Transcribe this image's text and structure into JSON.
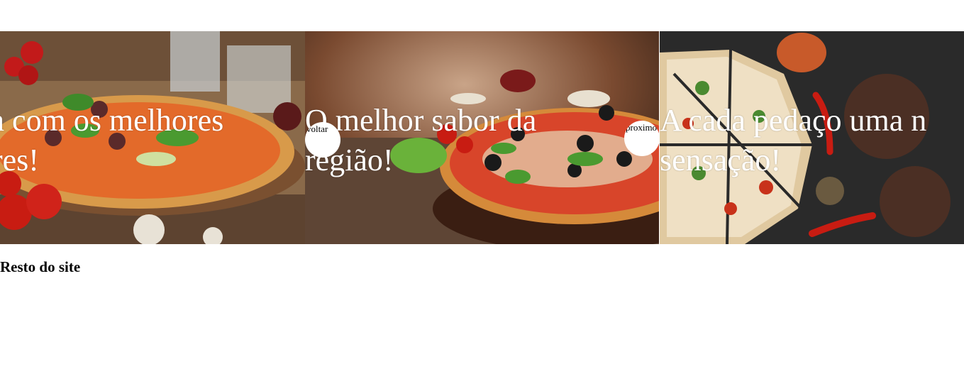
{
  "carousel": {
    "slides": [
      {
        "caption": "za com os melhores\nores!"
      },
      {
        "caption": "O melhor sabor da\nregião!"
      },
      {
        "caption": "A cada pedaço uma n\nsensação!"
      }
    ],
    "prev_label": "voltar",
    "next_label": "proximo"
  },
  "content": {
    "heading": "Resto do site"
  },
  "colors": {
    "caption": "#ffffff",
    "background": "#ffffff",
    "accent_red": "#c0301a"
  }
}
